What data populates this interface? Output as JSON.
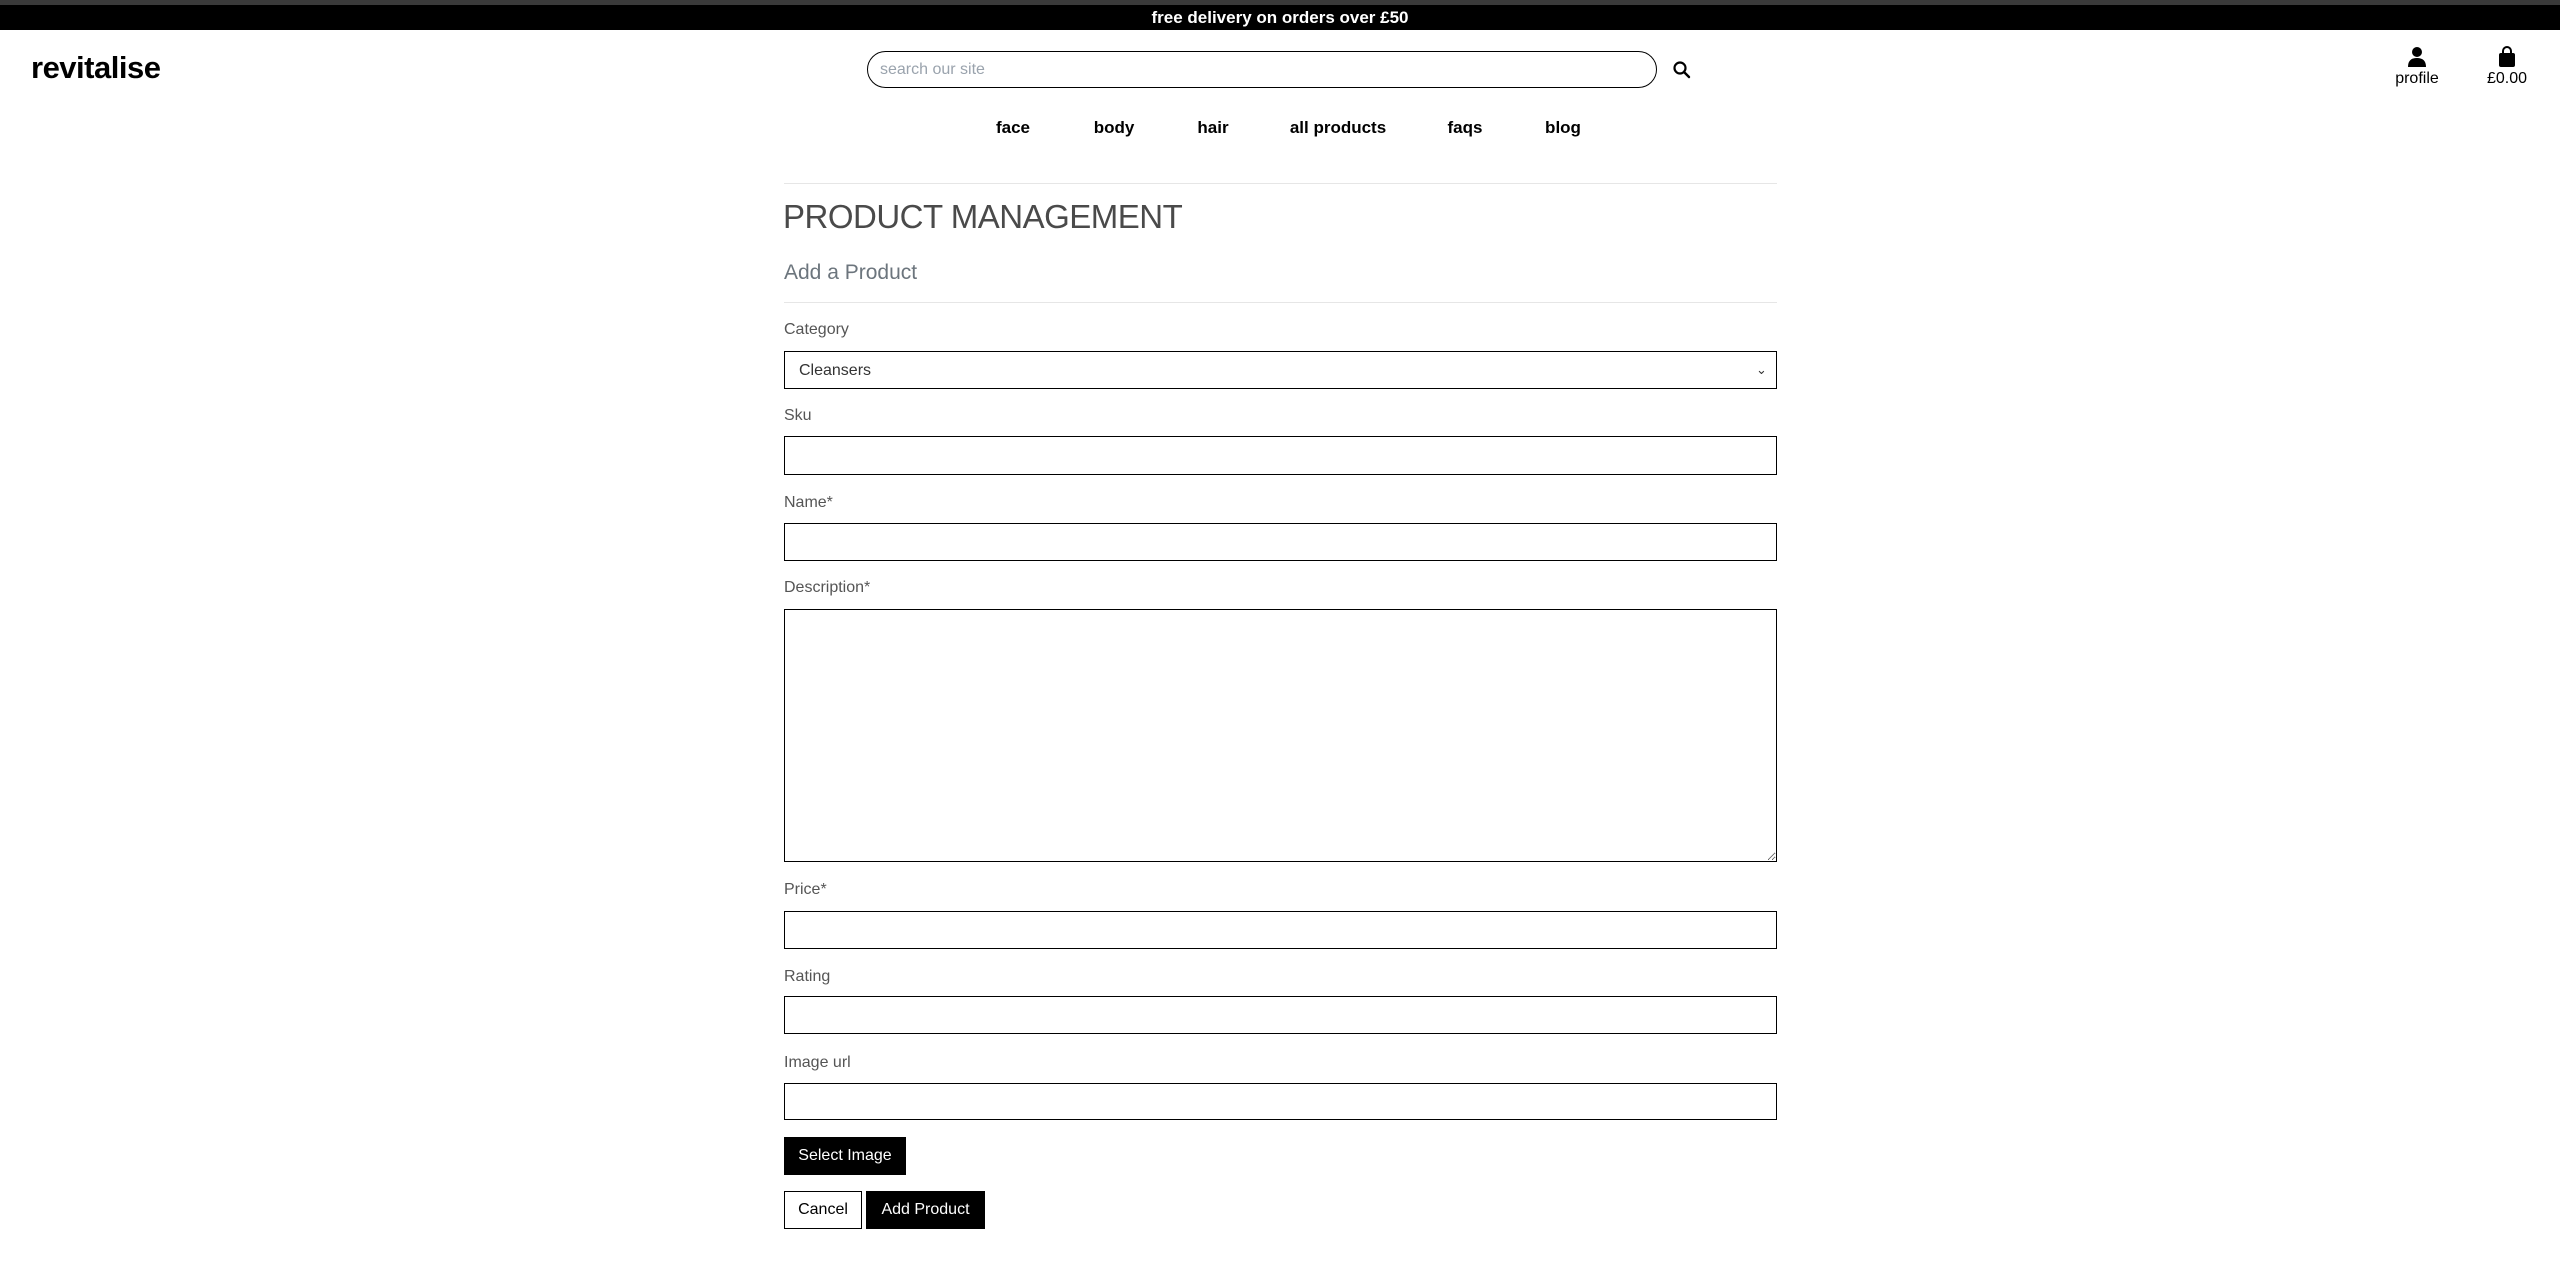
{
  "banner": {
    "text": "free delivery on orders over £50"
  },
  "header": {
    "logo": "revitalise",
    "search": {
      "placeholder": "search our site",
      "value": "",
      "icon": "search-icon"
    },
    "profile": {
      "label": "profile",
      "icon": "user-icon"
    },
    "cart": {
      "label": "£0.00",
      "icon": "shopping-bag-icon"
    }
  },
  "nav": {
    "items": [
      {
        "label": "face"
      },
      {
        "label": "body"
      },
      {
        "label": "hair"
      },
      {
        "label": "all products"
      },
      {
        "label": "faqs"
      },
      {
        "label": "blog"
      }
    ]
  },
  "main": {
    "title": "PRODUCT MANAGEMENT",
    "subtitle": "Add a Product",
    "form": {
      "category": {
        "label": "Category",
        "value": "Cleansers"
      },
      "sku": {
        "label": "Sku",
        "value": ""
      },
      "name": {
        "label": "Name*",
        "value": ""
      },
      "description": {
        "label": "Description*",
        "value": ""
      },
      "price": {
        "label": "Price*",
        "value": ""
      },
      "rating": {
        "label": "Rating",
        "value": ""
      },
      "image_url": {
        "label": "Image url",
        "value": ""
      },
      "select_image": "Select Image",
      "cancel": "Cancel",
      "submit": "Add Product"
    }
  }
}
